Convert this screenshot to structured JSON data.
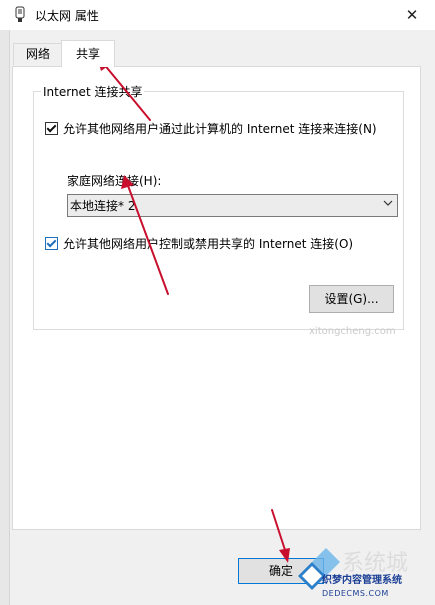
{
  "window": {
    "title": "以太网 属性",
    "close_symbol": "✕"
  },
  "tabs": [
    {
      "label": "网络"
    },
    {
      "label": "共享"
    }
  ],
  "group": {
    "title": "Internet 连接共享",
    "allow_connect_label": "允许其他网络用户通过此计算机的 Internet 连接来连接(N)",
    "allow_connect_checked": true,
    "home_network_label": "家庭网络连接(H):",
    "home_network_value": "本地连接* 2",
    "allow_control_label": "允许其他网络用户控制或禁用共享的 Internet 连接(O)",
    "allow_control_checked": true,
    "settings_label": "设置(G)..."
  },
  "buttons": {
    "ok_label": "确定"
  },
  "watermark": {
    "site_text": "织梦内容管理系统",
    "url_text": "DEDECMS.COM",
    "url_faint": "xitongcheng.com"
  },
  "colors": {
    "arrow": "#c8102e",
    "accent": "#0078d7",
    "watermark": "#1c3f95"
  }
}
